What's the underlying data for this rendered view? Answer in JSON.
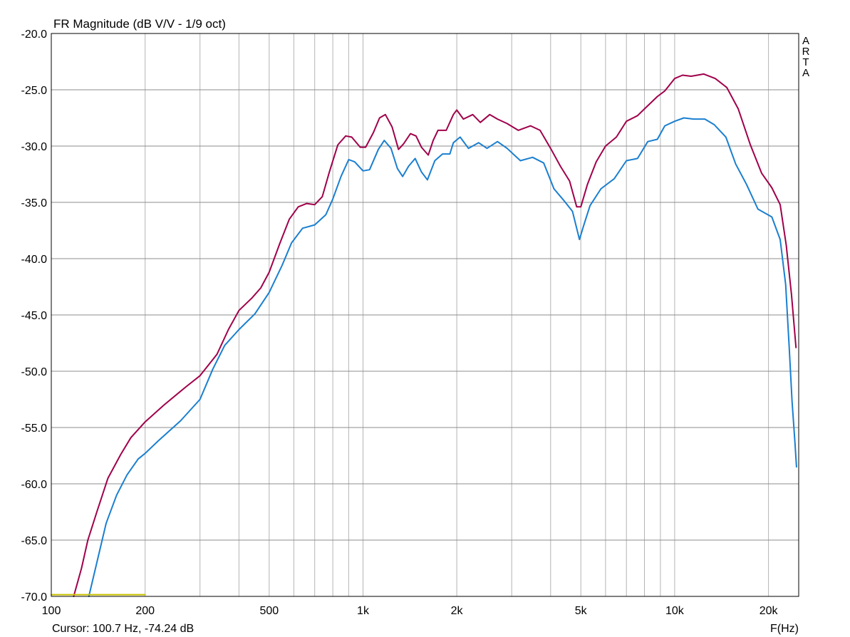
{
  "chart_data": {
    "type": "line",
    "title": "FR Magnitude (dB V/V - 1/9 oct)",
    "xlabel": "F(Hz)",
    "ylabel": "",
    "xscale": "log",
    "xlim": [
      100,
      25000
    ],
    "ylim": [
      -70,
      -20
    ],
    "grid": true,
    "brand": "ARTA",
    "cursor_text": "Cursor: 100.7 Hz, -74.24 dB",
    "x_ticks": [
      {
        "value": 100,
        "label": "100"
      },
      {
        "value": 200,
        "label": "200"
      },
      {
        "value": 500,
        "label": "500"
      },
      {
        "value": 1000,
        "label": "1k"
      },
      {
        "value": 2000,
        "label": "2k"
      },
      {
        "value": 5000,
        "label": "5k"
      },
      {
        "value": 10000,
        "label": "10k"
      },
      {
        "value": 20000,
        "label": "20k"
      }
    ],
    "y_ticks": [
      {
        "value": -20,
        "label": "-20.0"
      },
      {
        "value": -25,
        "label": "-25.0"
      },
      {
        "value": -30,
        "label": "-30.0"
      },
      {
        "value": -35,
        "label": "-35.0"
      },
      {
        "value": -40,
        "label": "-40.0"
      },
      {
        "value": -45,
        "label": "-45.0"
      },
      {
        "value": -50,
        "label": "-50.0"
      },
      {
        "value": -55,
        "label": "-55.0"
      },
      {
        "value": -60,
        "label": "-60.0"
      },
      {
        "value": -65,
        "label": "-65.0"
      },
      {
        "value": -70,
        "label": "-70.0"
      }
    ],
    "series": [
      {
        "color": "#a0004a",
        "points": [
          [
            118,
            -70
          ],
          [
            125,
            -67.5
          ],
          [
            131,
            -65
          ],
          [
            140,
            -62.5
          ],
          [
            152,
            -59.5
          ],
          [
            167,
            -57.4
          ],
          [
            180,
            -55.9
          ],
          [
            200,
            -54.5
          ],
          [
            230,
            -53
          ],
          [
            270,
            -51.4
          ],
          [
            300,
            -50.4
          ],
          [
            340,
            -48.5
          ],
          [
            370,
            -46.3
          ],
          [
            400,
            -44.6
          ],
          [
            440,
            -43.5
          ],
          [
            470,
            -42.6
          ],
          [
            500,
            -41.2
          ],
          [
            540,
            -38.7
          ],
          [
            580,
            -36.5
          ],
          [
            620,
            -35.4
          ],
          [
            660,
            -35.1
          ],
          [
            700,
            -35.2
          ],
          [
            740,
            -34.5
          ],
          [
            780,
            -32.3
          ],
          [
            830,
            -29.9
          ],
          [
            880,
            -29.1
          ],
          [
            920,
            -29.2
          ],
          [
            980,
            -30.1
          ],
          [
            1020,
            -30.1
          ],
          [
            1080,
            -28.8
          ],
          [
            1130,
            -27.5
          ],
          [
            1180,
            -27.2
          ],
          [
            1240,
            -28.3
          ],
          [
            1300,
            -30.3
          ],
          [
            1350,
            -29.8
          ],
          [
            1420,
            -28.9
          ],
          [
            1480,
            -29.1
          ],
          [
            1540,
            -30.1
          ],
          [
            1620,
            -30.8
          ],
          [
            1680,
            -29.5
          ],
          [
            1740,
            -28.6
          ],
          [
            1850,
            -28.6
          ],
          [
            1950,
            -27.2
          ],
          [
            2000,
            -26.8
          ],
          [
            2100,
            -27.6
          ],
          [
            2250,
            -27.2
          ],
          [
            2380,
            -27.9
          ],
          [
            2550,
            -27.2
          ],
          [
            2700,
            -27.6
          ],
          [
            2900,
            -28
          ],
          [
            3150,
            -28.6
          ],
          [
            3450,
            -28.2
          ],
          [
            3700,
            -28.6
          ],
          [
            4000,
            -30.2
          ],
          [
            4300,
            -31.8
          ],
          [
            4600,
            -33.1
          ],
          [
            4850,
            -35.4
          ],
          [
            5000,
            -35.4
          ],
          [
            5250,
            -33.4
          ],
          [
            5600,
            -31.4
          ],
          [
            6000,
            -30
          ],
          [
            6500,
            -29.2
          ],
          [
            7000,
            -27.8
          ],
          [
            7600,
            -27.3
          ],
          [
            8000,
            -26.7
          ],
          [
            8800,
            -25.6
          ],
          [
            9300,
            -25.1
          ],
          [
            10000,
            -24
          ],
          [
            10600,
            -23.7
          ],
          [
            11300,
            -23.8
          ],
          [
            12400,
            -23.6
          ],
          [
            13500,
            -24
          ],
          [
            14700,
            -24.8
          ],
          [
            16000,
            -26.7
          ],
          [
            17500,
            -29.9
          ],
          [
            19000,
            -32.4
          ],
          [
            20500,
            -33.7
          ],
          [
            21800,
            -35.2
          ],
          [
            22800,
            -38.8
          ],
          [
            23700,
            -43.2
          ],
          [
            24500,
            -47.9
          ]
        ]
      },
      {
        "color": "#1a7fd0",
        "points": [
          [
            132,
            -70
          ],
          [
            140,
            -67
          ],
          [
            150,
            -63.5
          ],
          [
            162,
            -61
          ],
          [
            175,
            -59.2
          ],
          [
            190,
            -57.8
          ],
          [
            200,
            -57.3
          ],
          [
            220,
            -56.2
          ],
          [
            260,
            -54.4
          ],
          [
            300,
            -52.5
          ],
          [
            330,
            -49.8
          ],
          [
            360,
            -47.7
          ],
          [
            400,
            -46.3
          ],
          [
            450,
            -44.9
          ],
          [
            500,
            -43
          ],
          [
            550,
            -40.6
          ],
          [
            590,
            -38.6
          ],
          [
            640,
            -37.3
          ],
          [
            700,
            -37
          ],
          [
            760,
            -36.1
          ],
          [
            800,
            -34.7
          ],
          [
            850,
            -32.7
          ],
          [
            900,
            -31.2
          ],
          [
            940,
            -31.4
          ],
          [
            1000,
            -32.2
          ],
          [
            1050,
            -32.1
          ],
          [
            1120,
            -30.3
          ],
          [
            1170,
            -29.5
          ],
          [
            1230,
            -30.2
          ],
          [
            1290,
            -32
          ],
          [
            1340,
            -32.7
          ],
          [
            1400,
            -31.8
          ],
          [
            1470,
            -31.1
          ],
          [
            1540,
            -32.3
          ],
          [
            1610,
            -33
          ],
          [
            1700,
            -31.3
          ],
          [
            1800,
            -30.7
          ],
          [
            1900,
            -30.7
          ],
          [
            1950,
            -29.7
          ],
          [
            2050,
            -29.2
          ],
          [
            2180,
            -30.2
          ],
          [
            2350,
            -29.7
          ],
          [
            2500,
            -30.2
          ],
          [
            2700,
            -29.6
          ],
          [
            2900,
            -30.2
          ],
          [
            3200,
            -31.3
          ],
          [
            3500,
            -31
          ],
          [
            3800,
            -31.5
          ],
          [
            4100,
            -33.8
          ],
          [
            4400,
            -34.8
          ],
          [
            4700,
            -35.8
          ],
          [
            4950,
            -38.3
          ],
          [
            5100,
            -37.1
          ],
          [
            5350,
            -35.3
          ],
          [
            5800,
            -33.8
          ],
          [
            6400,
            -32.9
          ],
          [
            7000,
            -31.3
          ],
          [
            7600,
            -31.1
          ],
          [
            8200,
            -29.6
          ],
          [
            8800,
            -29.4
          ],
          [
            9300,
            -28.2
          ],
          [
            10000,
            -27.8
          ],
          [
            10700,
            -27.5
          ],
          [
            11500,
            -27.6
          ],
          [
            12500,
            -27.6
          ],
          [
            13400,
            -28.1
          ],
          [
            14600,
            -29.2
          ],
          [
            15700,
            -31.6
          ],
          [
            17000,
            -33.4
          ],
          [
            18500,
            -35.6
          ],
          [
            20500,
            -36.3
          ],
          [
            21800,
            -38.3
          ],
          [
            22700,
            -42.3
          ],
          [
            23300,
            -47.8
          ],
          [
            23800,
            -52.7
          ],
          [
            24300,
            -56.2
          ],
          [
            24600,
            -58.5
          ]
        ]
      },
      {
        "color": "#c8c000",
        "points": [
          [
            100,
            -69.85
          ],
          [
            200,
            -69.85
          ]
        ]
      }
    ]
  }
}
